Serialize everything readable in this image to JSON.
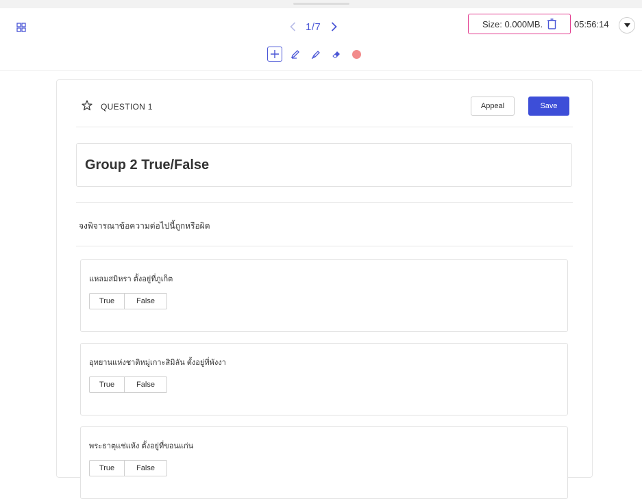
{
  "toolbar": {
    "page_current": "1",
    "page_total": "7",
    "page_indicator": "1/7",
    "size_label": "Size: 0.000MB.",
    "timer": "05:56:14",
    "accent_color": "#4a56d6",
    "highlight_border_color": "#e23a8e",
    "tools": [
      {
        "name": "add-icon",
        "active": true
      },
      {
        "name": "pen-icon",
        "active": false
      },
      {
        "name": "highlighter-icon",
        "active": false
      },
      {
        "name": "eraser-icon",
        "active": false
      },
      {
        "name": "color-dot",
        "color": "#f28b8b"
      }
    ]
  },
  "question": {
    "label": "QUESTION 1",
    "appeal_label": "Appeal",
    "save_label": "Save",
    "save_color": "#3d4ed8",
    "title": "Group 2 True/False",
    "instruction": "จงพิจารณาข้อความต่อไปนี้ถูกหรือผิด",
    "items": [
      {
        "statement": "แหลมสมิหรา ตั้งอยู่ที่ภูเก็ต",
        "true_label": "True",
        "false_label": "False"
      },
      {
        "statement": "อุทยานแห่งชาติหมู่เกาะสิมิลัน ตั้งอยู่ที่พังงา",
        "true_label": "True",
        "false_label": "False"
      },
      {
        "statement": "พระธาตุแช่แห้ง ตั้งอยู่ที่ขอนแก่น",
        "true_label": "True",
        "false_label": "False"
      }
    ]
  }
}
